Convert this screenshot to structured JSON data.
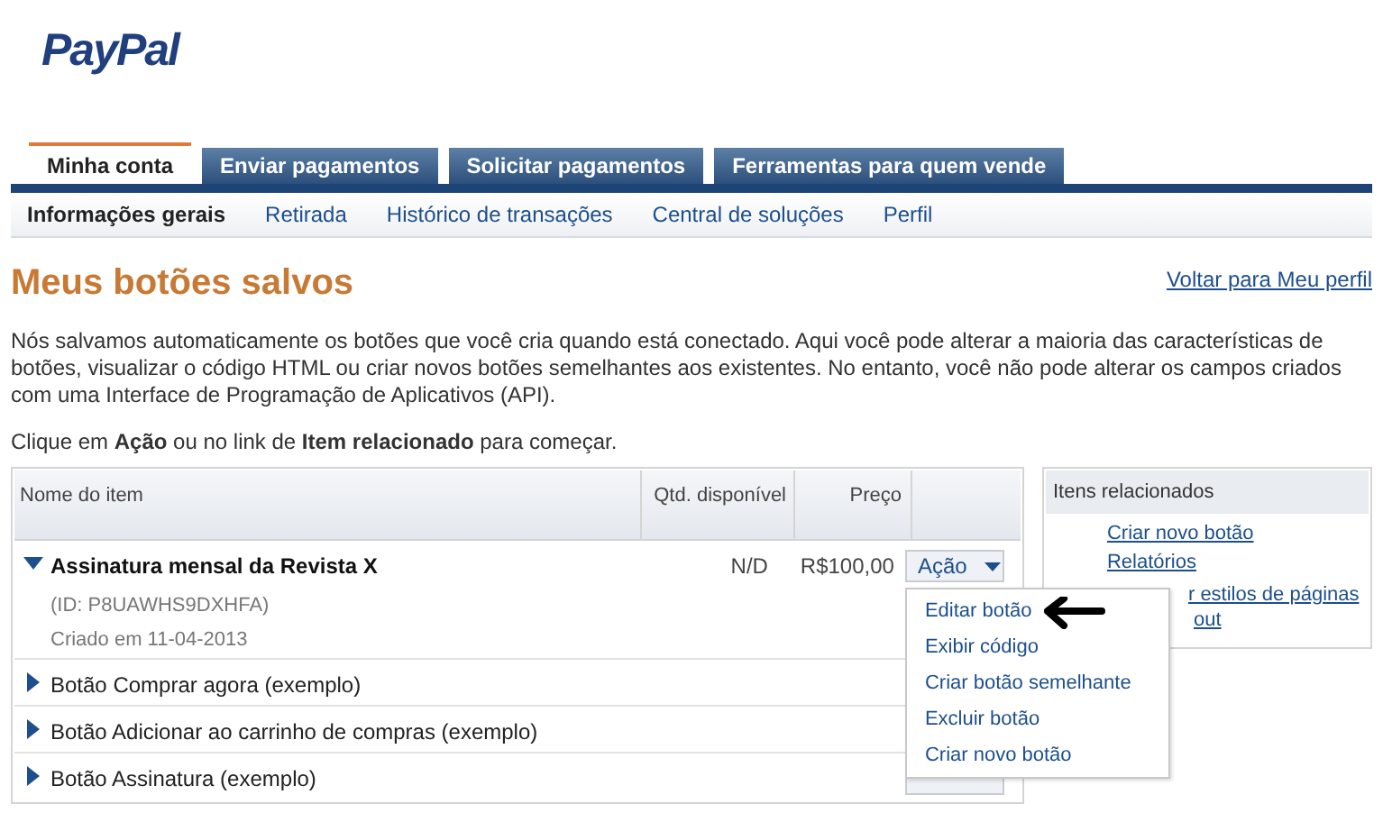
{
  "logo": "PayPal",
  "tabs": [
    {
      "label": "Minha conta",
      "selected": true
    },
    {
      "label": "Enviar pagamentos",
      "selected": false
    },
    {
      "label": "Solicitar pagamentos",
      "selected": false
    },
    {
      "label": "Ferramentas para quem vende",
      "selected": false
    }
  ],
  "subnav": [
    {
      "label": "Informações gerais",
      "selected": true
    },
    {
      "label": "Retirada",
      "selected": false
    },
    {
      "label": "Histórico de transações",
      "selected": false
    },
    {
      "label": "Central de soluções",
      "selected": false
    },
    {
      "label": "Perfil",
      "selected": false
    }
  ],
  "heading": "Meus botões salvos",
  "back_link": "Voltar para Meu perfil",
  "intro": "Nós salvamos automaticamente os botões que você cria quando está conectado. Aqui você pode alterar a maioria das características de botões, visualizar o código HTML ou criar novos botões semelhantes aos existentes. No entanto, você não pode alterar os campos criados com uma Interface de Programação de Aplicativos (API).",
  "hint": "Clique em **Ação** ou no link de **Item relacionado** para começar.",
  "table": {
    "columns": [
      "Nome do item",
      "Qtd. disponível",
      "Preço"
    ],
    "rows": [
      {
        "name": "Assinatura mensal da Revista X",
        "expanded": true,
        "details": [
          "(ID: P8UAWHS9DXHFA)",
          "Criado em 11-04-2013"
        ],
        "quantity": "N/D",
        "price": "R$100,00",
        "action": "Ação"
      },
      {
        "name": "Botão Comprar agora (exemplo)",
        "expanded": false
      },
      {
        "name": "Botão Adicionar ao carrinho de compras (exemplo)",
        "expanded": false
      },
      {
        "name": "Botão Assinatura (exemplo)",
        "expanded": false,
        "has_action": true
      }
    ]
  },
  "action_menu": {
    "items": [
      "Editar botão",
      "Exibir código",
      "Criar botão semelhante",
      "Excluir botão",
      "Criar novo botão"
    ]
  },
  "related": {
    "title": "Itens relacionados",
    "links": [
      {
        "lines": [
          "Criar novo botão"
        ]
      },
      {
        "lines": [
          "Relatórios"
        ]
      },
      {
        "lines": [
          "r estilos de páginas",
          "out"
        ]
      }
    ]
  }
}
